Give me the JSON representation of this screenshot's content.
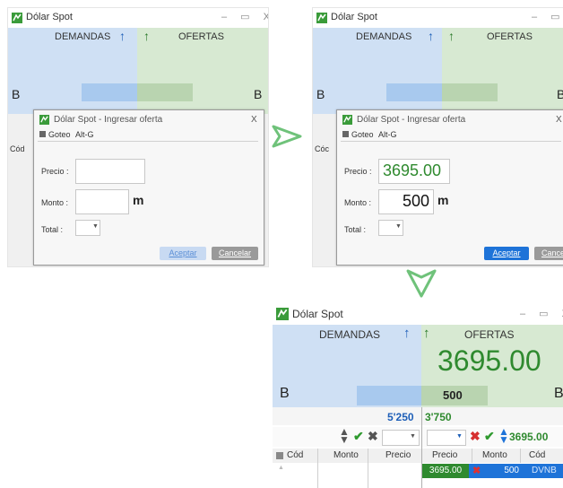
{
  "window_title": "Dólar Spot",
  "window_controls": "– ▭ X",
  "demandas_label": "DEMANDAS",
  "ofertas_label": "OFERTAS",
  "b_label": "B",
  "dialog": {
    "title": "Dólar Spot - Ingresar oferta",
    "close": "X",
    "goteo_label": "Goteo",
    "goteo_shortcut": "Alt-G",
    "precio_label": "Precio :",
    "monto_label": "Monto :",
    "total_label": "Total :",
    "monto_unit": "m",
    "aceptar": "Aceptar",
    "cancelar": "Cancelar"
  },
  "filled": {
    "precio": "3695.00",
    "monto": "500"
  },
  "panel1": {
    "cod_partial": "Cód"
  },
  "panel2": {
    "cod_partial": "Cóc"
  },
  "result": {
    "offer_price": "3695.00",
    "offer_amount": "500",
    "demand_total": "5'250",
    "offer_total": "3'750",
    "toolbar_price": "3695.00",
    "left_headers": [
      "Cód",
      "Monto",
      "Precio"
    ],
    "right_headers": [
      "Precio",
      "Monto",
      "Cód"
    ],
    "row": {
      "precio": "3695.00",
      "monto": "500",
      "cod": "DVNB"
    }
  },
  "colors": {
    "accent_blue": "#1e73d8",
    "green_text": "#2f8a2f",
    "green_arrow_outline": "#6fc27a"
  }
}
